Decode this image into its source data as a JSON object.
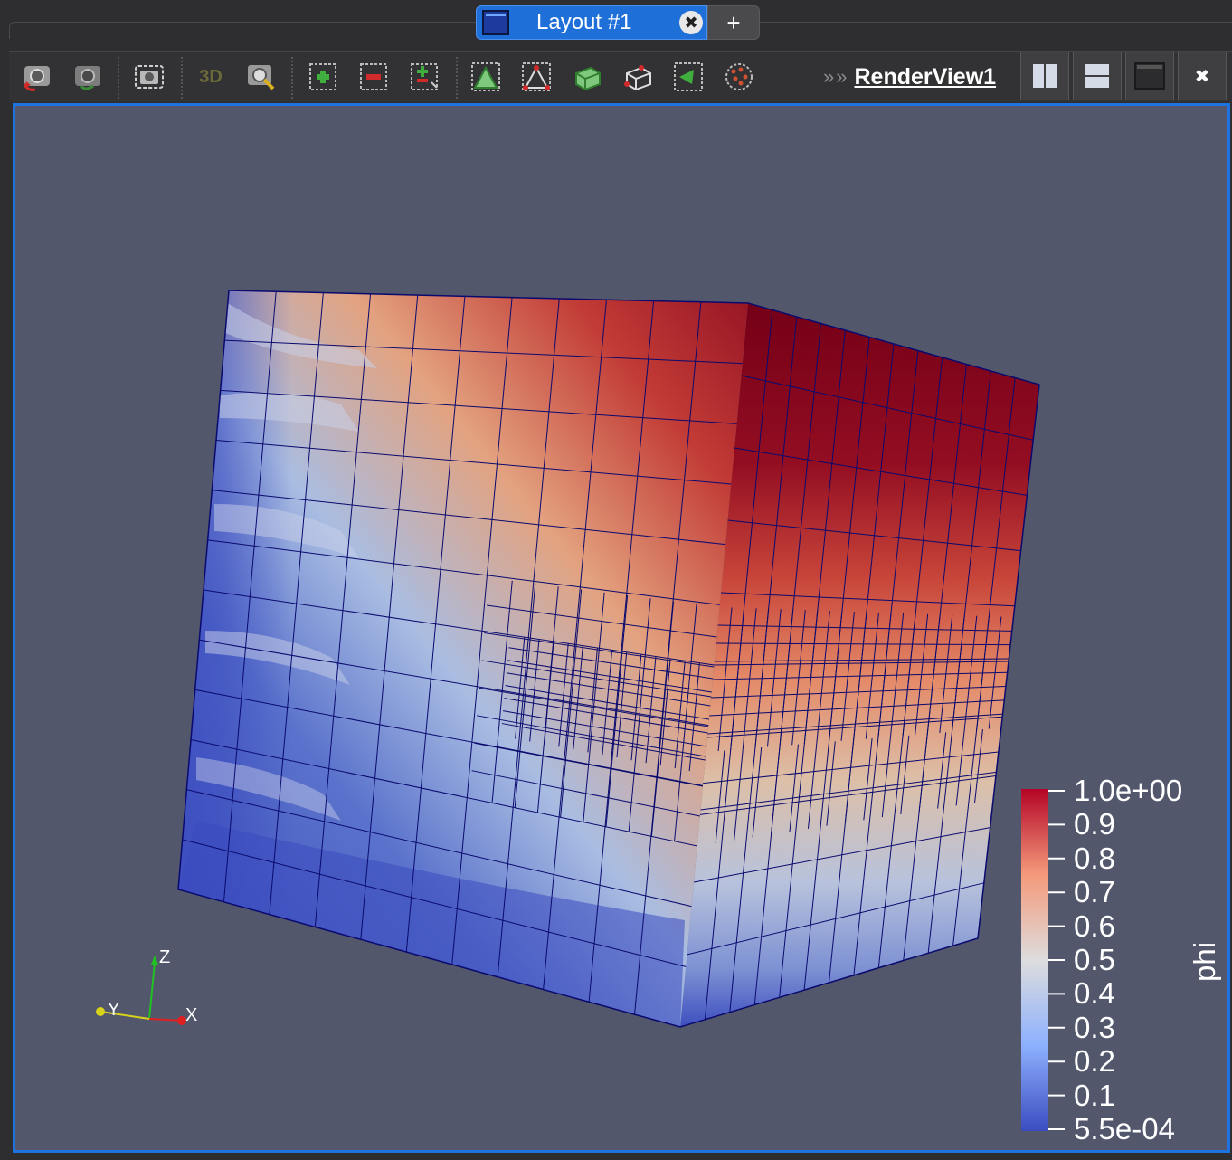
{
  "tabs": {
    "active_label": "Layout #1",
    "close_glyph": "✖",
    "add_glyph": "+"
  },
  "toolbar": {
    "buttons": [
      {
        "name": "reset-camera-icon"
      },
      {
        "name": "reset-camera-closest-icon"
      },
      {
        "name": "capture-screenshot-icon"
      },
      {
        "name": "toggle-3d-button",
        "label": "3D"
      },
      {
        "name": "zoom-to-box-icon"
      },
      {
        "name": "select-cells-on-icon"
      },
      {
        "name": "deselect-cells-icon"
      },
      {
        "name": "toggle-selection-icon"
      },
      {
        "name": "select-points-on-icon"
      },
      {
        "name": "select-cells-through-icon"
      },
      {
        "name": "select-points-through-icon"
      },
      {
        "name": "select-polygon-icon"
      },
      {
        "name": "select-block-icon"
      },
      {
        "name": "interactive-select-icon"
      }
    ],
    "chevron_glyph": "»",
    "render_view_name": "RenderView1",
    "layout_buttons": [
      {
        "name": "split-horizontal-icon"
      },
      {
        "name": "split-vertical-icon"
      },
      {
        "name": "maximize-view-icon"
      },
      {
        "name": "close-view-icon",
        "glyph": "✖"
      }
    ]
  },
  "render_view": {
    "background_color": "#52576c",
    "mesh_edge_color": "#0a0a6e",
    "colormap_low": "#3b4cc0",
    "colormap_mid": "#dddddd",
    "colormap_high": "#b40426"
  },
  "color_legend": {
    "title": "phi",
    "labels": [
      "1.0e+00",
      "0.9",
      "0.8",
      "0.7",
      "0.6",
      "0.5",
      "0.4",
      "0.3",
      "0.2",
      "0.1",
      "5.5e-04"
    ]
  },
  "orientation_axes": {
    "x": "X",
    "y": "Y",
    "z": "Z"
  }
}
